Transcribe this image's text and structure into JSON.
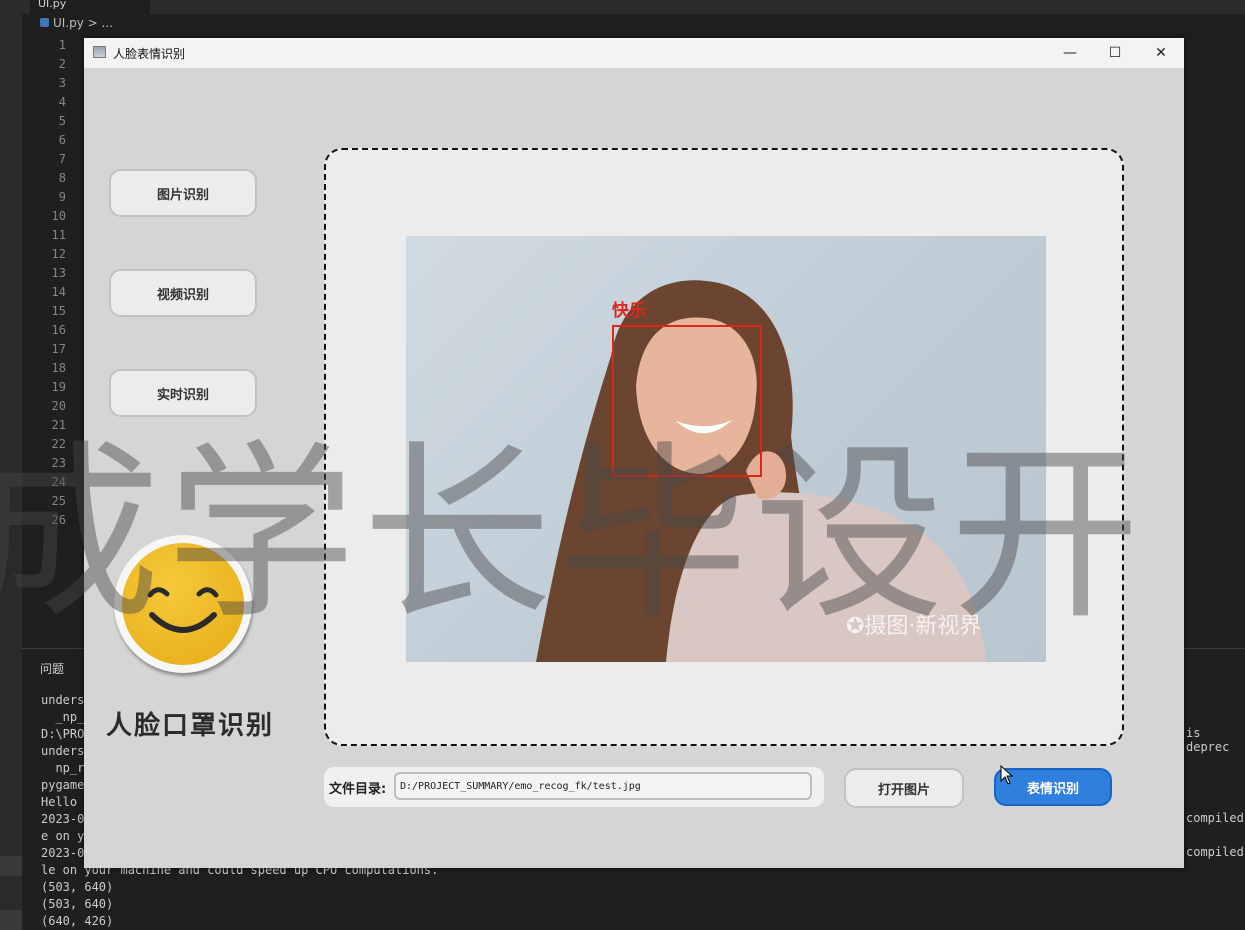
{
  "editor": {
    "tab": "UI.py",
    "breadcrumb": "UI.py > ...",
    "line_numbers": [
      "1",
      "2",
      "3",
      "4",
      "5",
      "6",
      "7",
      "8",
      "9",
      "10",
      "11",
      "12",
      "13",
      "14",
      "15",
      "16",
      "17",
      "18",
      "19",
      "20",
      "21",
      "22",
      "23",
      "24",
      "25",
      "26"
    ],
    "panel_tab": "问题",
    "terminal_lines": [
      "unders",
      "  _np_",
      "D:\\PRO",
      "unders",
      "  np_r",
      "pygame",
      "Hello ",
      "2023-0",
      "e on y",
      "2023-0",
      "le on your machine and could speed up CPU computations.",
      "(503, 640)",
      "(503, 640)",
      "(640, 426)"
    ],
    "terminal_right": [
      "is deprec",
      "compiled",
      "compiled"
    ]
  },
  "window": {
    "title": "人脸表情识别",
    "minimize": "—",
    "maximize": "☐",
    "close": "✕"
  },
  "sidebar": {
    "buttons": [
      {
        "label": "图片识别"
      },
      {
        "label": "视频识别"
      },
      {
        "label": "实时识别"
      }
    ],
    "caption": "人脸口罩识别"
  },
  "result": {
    "emotion_label": "快乐",
    "photo_watermark": "✪摄图·新视界"
  },
  "footer": {
    "path_label": "文件目录:",
    "path_value": "D:/PROJECT_SUMMARY/emo_recog_fk/test.jpg",
    "open_button": "打开图片",
    "recognize_button": "表情识别"
  },
  "overlay_watermark": "成学长毕设开",
  "colors": {
    "accent": "#2f7fdf",
    "face_box": "#e0261c"
  }
}
